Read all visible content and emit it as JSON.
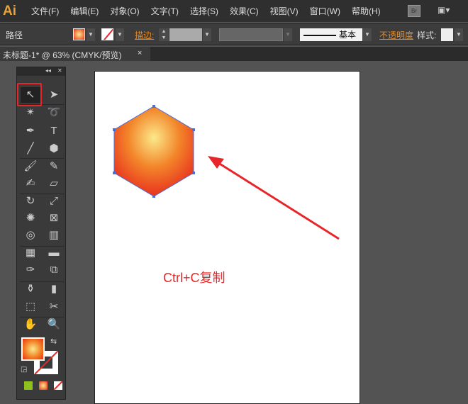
{
  "app": {
    "logo": "Ai",
    "bridge": "Br",
    "workspace": "▣▾"
  },
  "menu": [
    "文件(F)",
    "编辑(E)",
    "对象(O)",
    "文字(T)",
    "选择(S)",
    "效果(C)",
    "视图(V)",
    "窗口(W)",
    "帮助(H)"
  ],
  "control": {
    "selection_label": "路径",
    "stroke_label": "描边:",
    "stroke_profile": "基本",
    "opacity_label": "不透明度",
    "style_label": "样式:"
  },
  "document_tab": {
    "title": "未标题-1* @ 63% (CMYK/预览)",
    "close": "×"
  },
  "toolbox": {
    "collapse": "◂◂",
    "close": "✕",
    "tools": [
      [
        "selection",
        "↖"
      ],
      [
        "direct-selection",
        "➤"
      ],
      [
        "magic-wand",
        "✴"
      ],
      [
        "lasso",
        "➰"
      ],
      [
        "pen",
        "✒"
      ],
      [
        "type",
        "T"
      ],
      [
        "line",
        "╱"
      ],
      [
        "polygon",
        "⬢"
      ],
      [
        "paintbrush",
        "🖌"
      ],
      [
        "pencil",
        "✎"
      ],
      [
        "blob-brush",
        "✍"
      ],
      [
        "eraser",
        "▱"
      ],
      [
        "rotate",
        "↻"
      ],
      [
        "scale",
        "⤢"
      ],
      [
        "warp",
        "✺"
      ],
      [
        "free-transform",
        "⊠"
      ],
      [
        "shape-builder",
        "◎"
      ],
      [
        "graph",
        "▥"
      ],
      [
        "mesh",
        "▦"
      ],
      [
        "gradient",
        "▬"
      ],
      [
        "eyedropper",
        "✑"
      ],
      [
        "blend",
        "⧉"
      ],
      [
        "symbol-sprayer",
        "⚱"
      ],
      [
        "column-graph",
        "▮"
      ],
      [
        "artboard",
        "⬚"
      ],
      [
        "slice",
        "✂"
      ],
      [
        "hand",
        "✋"
      ],
      [
        "zoom",
        "🔍"
      ]
    ]
  },
  "colors": {
    "accent_red": "#e8262a",
    "fill_gradient_center": "#fbe98a",
    "fill_gradient_edge": "#e8321e",
    "selection_blue": "#4a6fd8"
  },
  "annotation": "Ctrl+C复制"
}
